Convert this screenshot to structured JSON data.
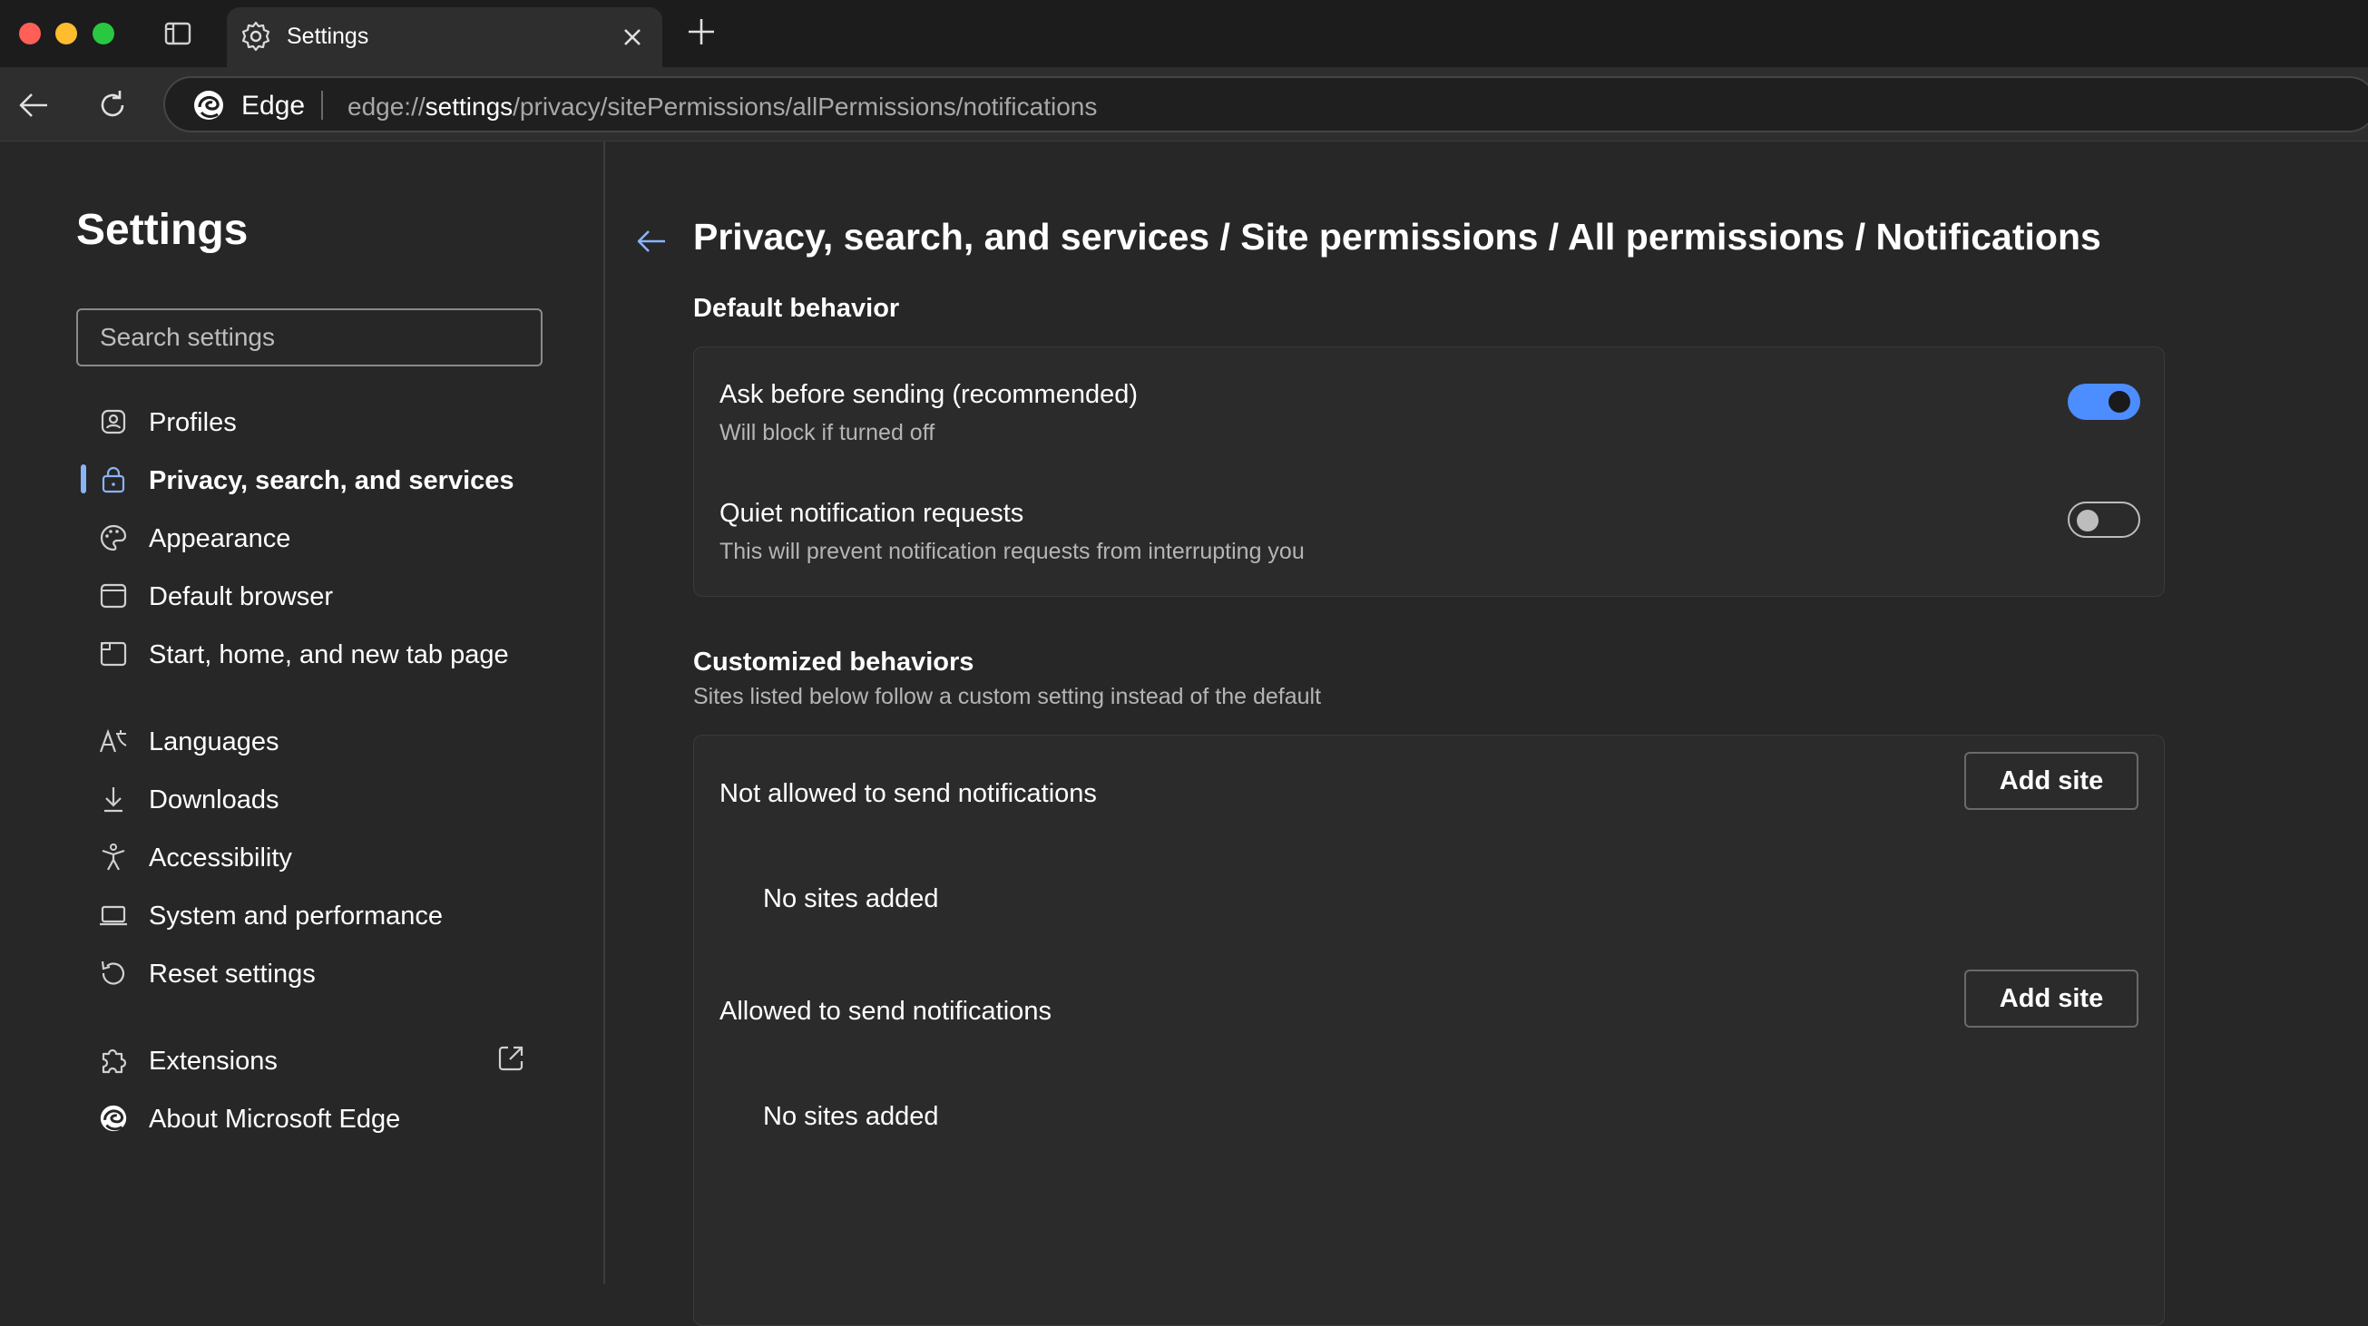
{
  "browser": {
    "tab_title": "Settings",
    "site_label": "Edge",
    "url_prefix": "edge://",
    "url_highlight": "settings",
    "url_rest": "/privacy/sitePermissions/allPermissions/notifications"
  },
  "sidebar": {
    "title": "Settings",
    "search_placeholder": "Search settings",
    "items": [
      {
        "label": "Profiles",
        "icon": "profile-icon"
      },
      {
        "label": "Privacy, search, and services",
        "icon": "lock-icon",
        "active": true
      },
      {
        "label": "Appearance",
        "icon": "palette-icon"
      },
      {
        "label": "Default browser",
        "icon": "browser-window-icon"
      },
      {
        "label": "Start, home, and new tab page",
        "icon": "home-page-icon"
      },
      {
        "label": "Languages",
        "icon": "languages-icon"
      },
      {
        "label": "Downloads",
        "icon": "download-icon"
      },
      {
        "label": "Accessibility",
        "icon": "accessibility-icon"
      },
      {
        "label": "System and performance",
        "icon": "laptop-icon"
      },
      {
        "label": "Reset settings",
        "icon": "reset-icon"
      },
      {
        "label": "Extensions",
        "icon": "puzzle-icon"
      },
      {
        "label": "About Microsoft Edge",
        "icon": "edge-logo-icon"
      }
    ]
  },
  "main": {
    "title": "Privacy, search, and services / Site permissions / All permissions / Notifications",
    "default_behavior": {
      "heading": "Default behavior",
      "ask": {
        "title": "Ask before sending (recommended)",
        "subtitle": "Will block if turned off",
        "enabled": true
      },
      "quiet": {
        "title": "Quiet notification requests",
        "subtitle": "This will prevent notification requests from interrupting you",
        "enabled": false
      }
    },
    "customized": {
      "heading": "Customized behaviors",
      "subtitle": "Sites listed below follow a custom setting instead of the default",
      "blocked": {
        "title": "Not allowed to send notifications",
        "button": "Add site",
        "empty": "No sites added"
      },
      "allowed": {
        "title": "Allowed to send notifications",
        "button": "Add site",
        "empty": "No sites added"
      }
    }
  },
  "colors": {
    "accent": "#4c8dff",
    "active_bar": "#8ab4f8",
    "background": "#272727"
  }
}
